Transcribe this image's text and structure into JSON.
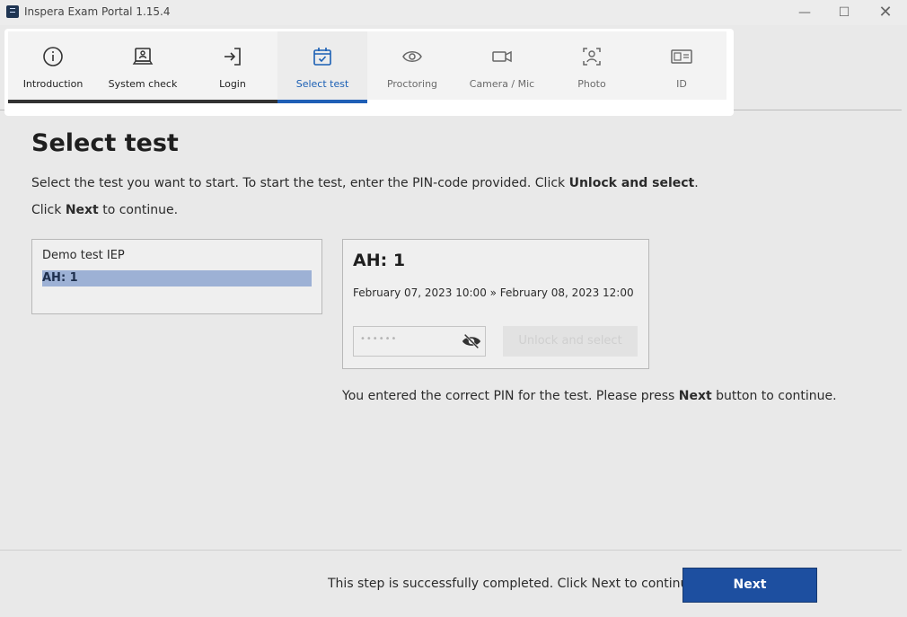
{
  "window": {
    "title": "Inspera Exam Portal 1.15.4"
  },
  "steps": [
    {
      "label": "Introduction",
      "icon": "info-icon"
    },
    {
      "label": "System check",
      "icon": "laptop-user-icon"
    },
    {
      "label": "Login",
      "icon": "login-icon"
    },
    {
      "label": "Select test",
      "icon": "calendar-check-icon"
    },
    {
      "label": "Proctoring",
      "icon": "eye-icon"
    },
    {
      "label": "Camera / Mic",
      "icon": "video-camera-icon"
    },
    {
      "label": "Photo",
      "icon": "face-scan-icon"
    },
    {
      "label": "ID",
      "icon": "id-card-icon"
    }
  ],
  "page": {
    "title": "Select test",
    "instruction_prefix": "Select the test you want to start. To start the test, enter the PIN-code provided. Click ",
    "instruction_bold": "Unlock and select",
    "instruction_suffix": ".",
    "continue_prefix": "Click ",
    "continue_bold": "Next",
    "continue_suffix": " to continue."
  },
  "test_list": {
    "group": "Demo test IEP",
    "selected": "AH: 1"
  },
  "test_card": {
    "title": "AH: 1",
    "dates": "February 07, 2023 10:00 » February 08, 2023 12:00",
    "pin_value": "••••••",
    "unlock_label": "Unlock and select"
  },
  "message": {
    "prefix": "You entered the correct PIN for the test. Please press ",
    "bold": "Next",
    "suffix": " button to continue."
  },
  "footer": {
    "status": "This step is successfully completed. Click Next to continue.",
    "next_label": "Next"
  },
  "colors": {
    "accent": "#1f5fb6",
    "next_button": "#1d4fa0",
    "selection": "#9db1d5"
  }
}
